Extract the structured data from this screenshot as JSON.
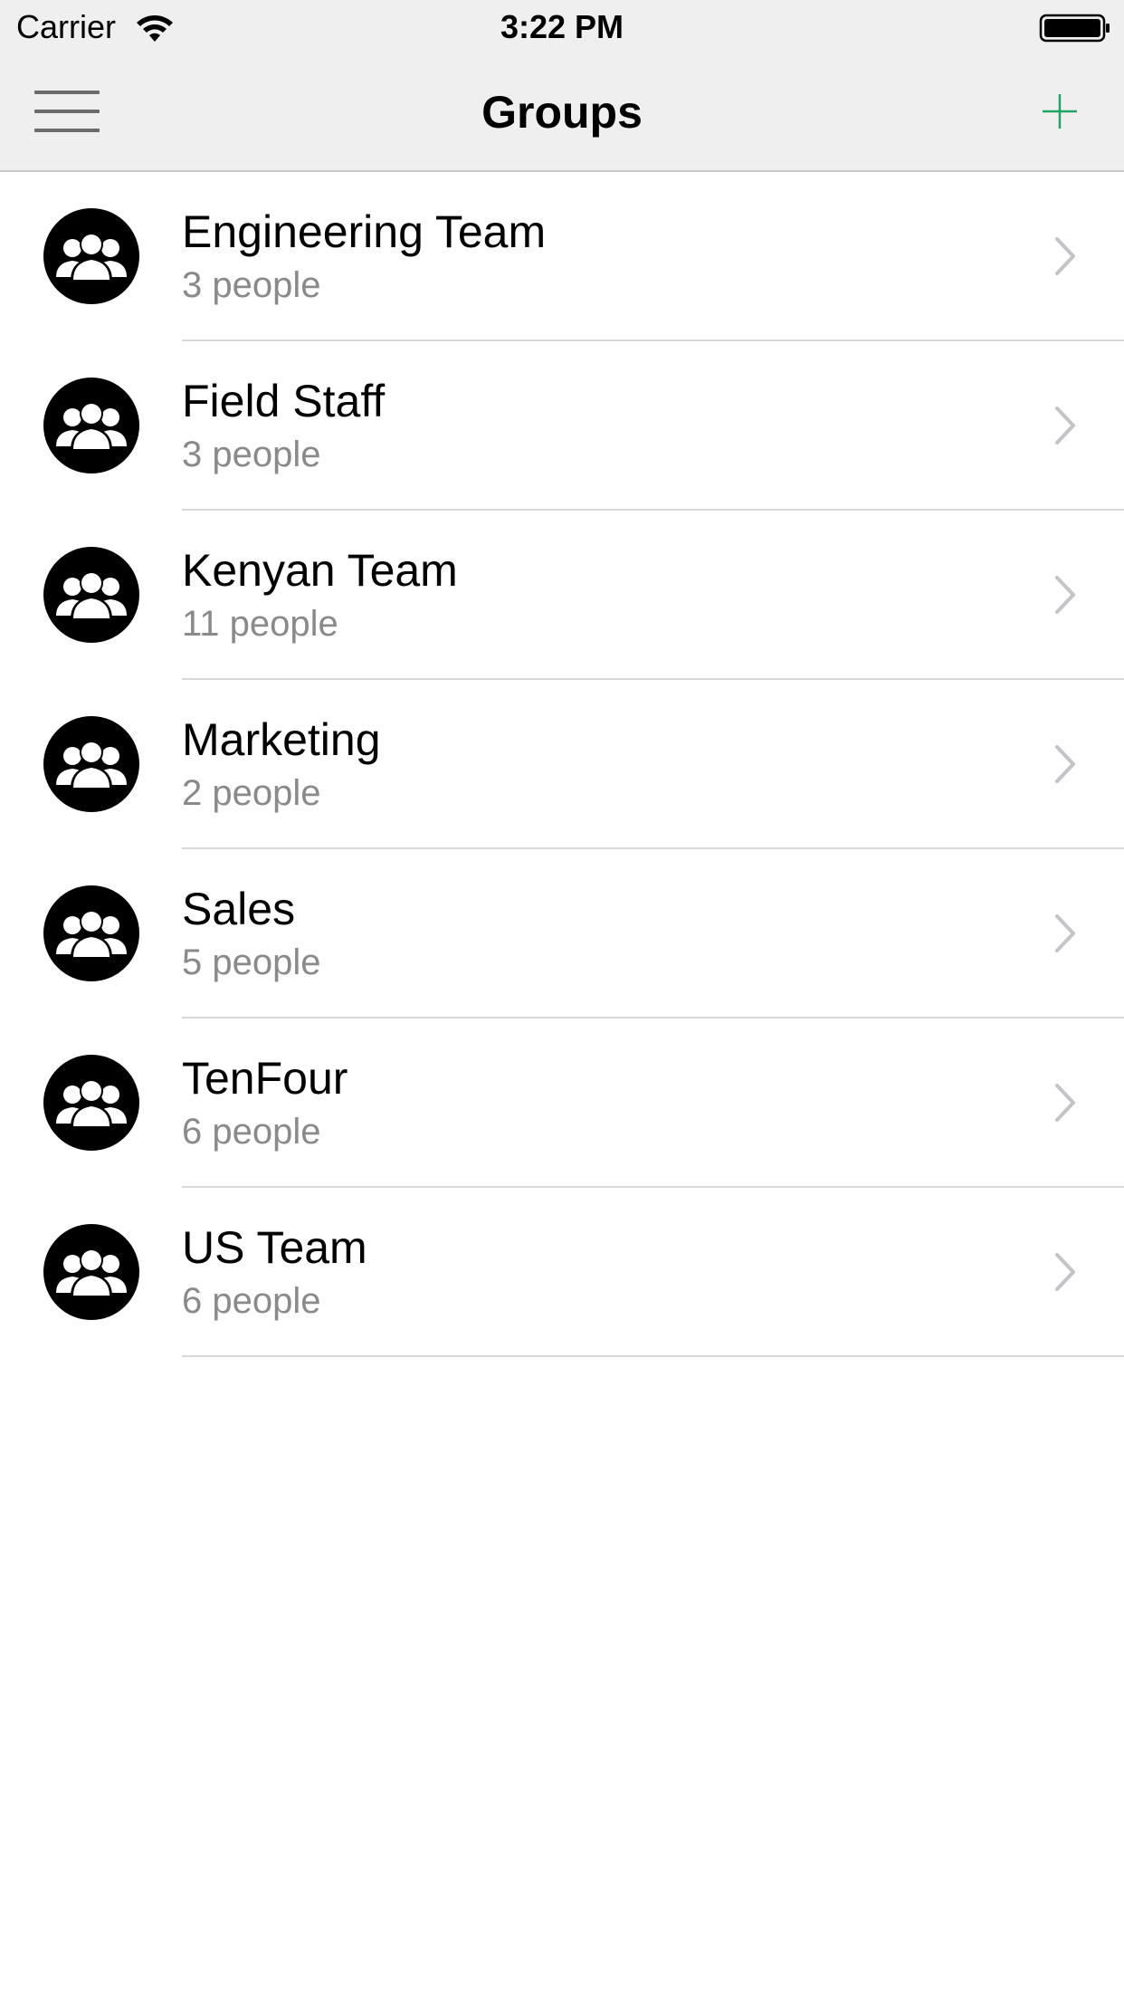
{
  "status_bar": {
    "carrier": "Carrier",
    "time": "3:22 PM",
    "wifi_icon": "wifi-icon",
    "battery_icon": "battery-icon"
  },
  "nav": {
    "title": "Groups",
    "menu_icon": "hamburger-menu-icon",
    "add_icon": "plus-icon",
    "accent_color": "#1fa463"
  },
  "groups": [
    {
      "name": "Engineering Team",
      "count": "3 people"
    },
    {
      "name": "Field Staff",
      "count": "3 people"
    },
    {
      "name": "Kenyan Team",
      "count": "11 people"
    },
    {
      "name": "Marketing",
      "count": "2 people"
    },
    {
      "name": "Sales",
      "count": "5 people"
    },
    {
      "name": "TenFour",
      "count": "6 people"
    },
    {
      "name": "US Team",
      "count": "6 people"
    }
  ],
  "row_icons": {
    "avatar_icon": "group-people-icon",
    "disclosure_icon": "chevron-right-icon"
  }
}
